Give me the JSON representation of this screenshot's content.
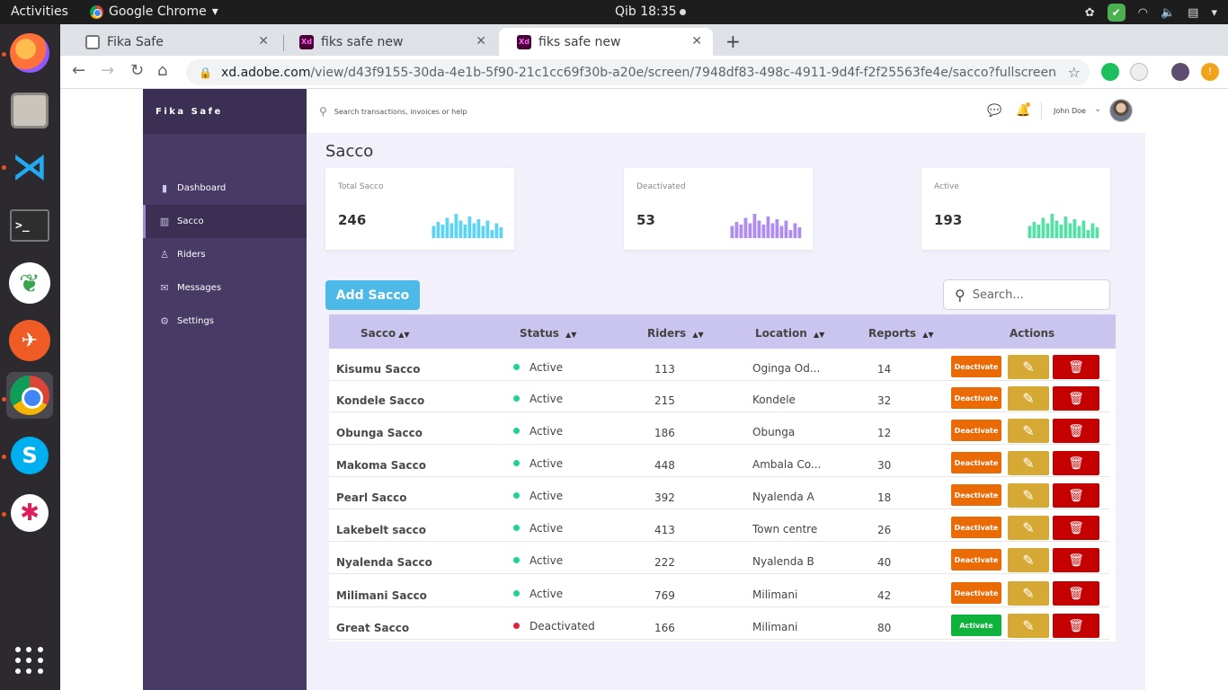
{
  "os": {
    "activities": "Activities",
    "app_name": "Google Chrome",
    "clock": "Qib 18:35"
  },
  "browser": {
    "tabs": [
      {
        "title": "Fika Safe"
      },
      {
        "title": "fiks safe new"
      },
      {
        "title": "fiks safe new"
      }
    ],
    "url_host": "xd.adobe.com",
    "url_path": "/view/d43f9155-30da-4e1b-5f90-21c1cc69f30b-a20e/screen/7948df83-498c-4911-9d4f-f2f25563fe4e/sacco?fullscreen"
  },
  "sidebar": {
    "brand": "Fika Safe",
    "items": [
      {
        "label": "Dashboard",
        "icon": "bar-chart-icon"
      },
      {
        "label": "Sacco",
        "icon": "barcode-icon"
      },
      {
        "label": "Riders",
        "icon": "user-icon"
      },
      {
        "label": "Messages",
        "icon": "mail-icon"
      },
      {
        "label": "Settings",
        "icon": "gear-icon"
      }
    ]
  },
  "header": {
    "search_placeholder": "Search transactions, invoices or help",
    "username": "John Doe"
  },
  "page": {
    "title": "Sacco",
    "add_button": "Add Sacco",
    "table_search_placeholder": "Search..."
  },
  "stats": [
    {
      "label": "Total Sacco",
      "value": "246",
      "color": "#5fd3f3",
      "bars": [
        0.45,
        0.6,
        0.5,
        0.75,
        0.55,
        0.9,
        0.65,
        0.5,
        0.8,
        0.55,
        0.7,
        0.45,
        0.65,
        0.3,
        0.55,
        0.4
      ]
    },
    {
      "label": "Deactivated",
      "value": "53",
      "color": "#b18cf0",
      "bars": [
        0.45,
        0.6,
        0.5,
        0.75,
        0.55,
        0.9,
        0.65,
        0.5,
        0.8,
        0.55,
        0.7,
        0.45,
        0.65,
        0.3,
        0.55,
        0.4
      ]
    },
    {
      "label": "Active",
      "value": "193",
      "color": "#54e0a6",
      "bars": [
        0.45,
        0.6,
        0.5,
        0.75,
        0.55,
        0.9,
        0.65,
        0.5,
        0.8,
        0.55,
        0.7,
        0.45,
        0.65,
        0.3,
        0.55,
        0.4
      ]
    }
  ],
  "table": {
    "columns": [
      "Sacco",
      "Status",
      "Riders",
      "Location",
      "Reports",
      "Actions"
    ],
    "rows": [
      {
        "sacco": "Kisumu Sacco",
        "status": "Active",
        "riders": "113",
        "location": "Oginga Od...",
        "reports": "14",
        "action": "Deactivate"
      },
      {
        "sacco": "Kondele Sacco",
        "status": "Active",
        "riders": "215",
        "location": "Kondele",
        "reports": "32",
        "action": "Deactivate"
      },
      {
        "sacco": "Obunga Sacco",
        "status": "Active",
        "riders": "186",
        "location": "Obunga",
        "reports": "12",
        "action": "Deactivate"
      },
      {
        "sacco": "Makoma Sacco",
        "status": "Active",
        "riders": "448",
        "location": "Ambala Co...",
        "reports": "30",
        "action": "Deactivate"
      },
      {
        "sacco": "Pearl Sacco",
        "status": "Active",
        "riders": "392",
        "location": "Nyalenda A",
        "reports": "18",
        "action": "Deactivate"
      },
      {
        "sacco": "Lakebelt sacco",
        "status": "Active",
        "riders": "413",
        "location": "Town centre",
        "reports": "26",
        "action": "Deactivate"
      },
      {
        "sacco": "Nyalenda Sacco",
        "status": "Active",
        "riders": "222",
        "location": "Nyalenda B",
        "reports": "40",
        "action": "Deactivate"
      },
      {
        "sacco": "Milimani Sacco",
        "status": "Active",
        "riders": "769",
        "location": "Milimani",
        "reports": "42",
        "action": "Deactivate"
      },
      {
        "sacco": "Great Sacco",
        "status": "Deactivated",
        "riders": "166",
        "location": "Milimani",
        "reports": "80",
        "action": "Activate"
      }
    ]
  },
  "colors": {
    "active_dot": "#1ed48f",
    "deactivated_dot": "#e0243a",
    "deactivate_button": "#ea6b06",
    "activate_button": "#0fb23a"
  }
}
